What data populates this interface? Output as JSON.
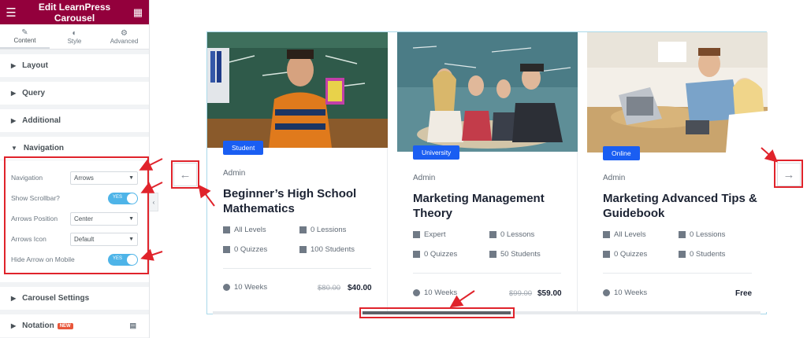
{
  "editor": {
    "title": "Edit LearnPress Carousel",
    "tabs": [
      {
        "label": "Content",
        "icon": "pencil-icon"
      },
      {
        "label": "Style",
        "icon": "contrast-icon"
      },
      {
        "label": "Advanced",
        "icon": "gear-icon"
      }
    ],
    "sections": {
      "layout": "Layout",
      "query": "Query",
      "additional": "Additional",
      "navigation": "Navigation",
      "carousel_settings": "Carousel Settings",
      "notation": "Notation",
      "notation_badge": "NEW"
    },
    "navigation_controls": {
      "navigation_label": "Navigation",
      "navigation_value": "Arrows",
      "show_scrollbar_label": "Show Scrollbar?",
      "show_scrollbar_state": "YES",
      "arrows_position_label": "Arrows Position",
      "arrows_position_value": "Center",
      "arrows_icon_label": "Arrows Icon",
      "arrows_icon_value": "Default",
      "hide_arrow_mobile_label": "Hide Arrow on Mobile",
      "hide_arrow_mobile_state": "YES"
    }
  },
  "carousel": {
    "cards": [
      {
        "tag": "Student",
        "author": "Admin",
        "title": "Beginner’s High School Mathematics",
        "level": "All Levels",
        "lessons": "0 Lessions",
        "quizzes": "0 Quizzes",
        "students": "100 Students",
        "duration": "10 Weeks",
        "old_price": "$80.00",
        "price": "$40.00"
      },
      {
        "tag": "University",
        "author": "Admin",
        "title": "Marketing Management Theory",
        "level": "Expert",
        "lessons": "0 Lessons",
        "quizzes": "0 Quizzes",
        "students": "50 Students",
        "duration": "10 Weeks",
        "old_price": "$99.00",
        "price": "$59.00"
      },
      {
        "tag": "Online",
        "author": "Admin",
        "title": "Marketing Advanced Tips & Guidebook",
        "level": "All Levels",
        "lessons": "0 Lessions",
        "quizzes": "0 Quizzes",
        "students": "0 Students",
        "duration": "10 Weeks",
        "old_price": "",
        "price": "Free"
      }
    ],
    "prev_arrow": "←",
    "next_arrow": "→"
  },
  "colors": {
    "editor_header": "#93003c",
    "tag_blue": "#1a5ef2",
    "toggle_on": "#4eb4e8",
    "annotation_red": "#e0232b"
  }
}
